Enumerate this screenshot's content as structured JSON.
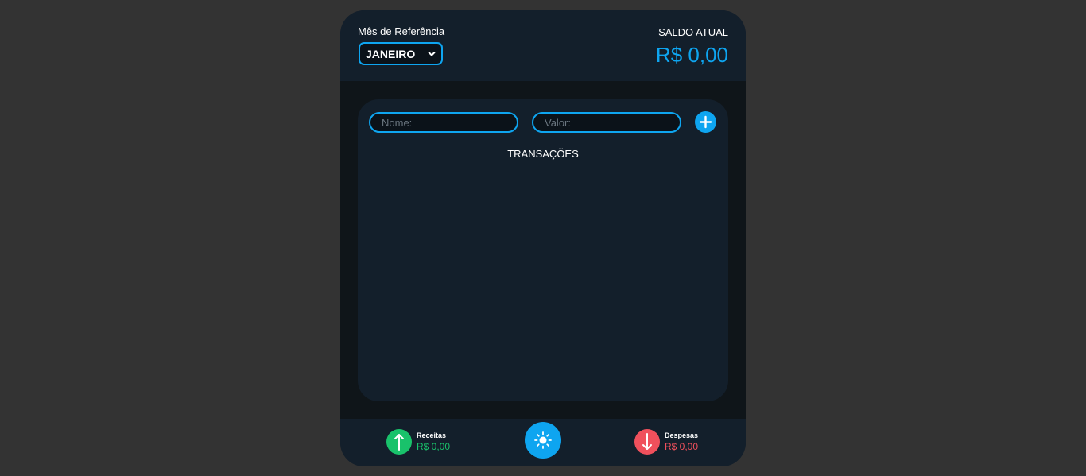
{
  "header": {
    "month_label": "Mês de Referência",
    "selected_month": "JANEIRO",
    "saldo_label": "SALDO ATUAL",
    "saldo_value": "R$ 0,00"
  },
  "form": {
    "nome_placeholder": "Nome:",
    "valor_placeholder": "Valor:",
    "add_icon": "plus-icon"
  },
  "transactions": {
    "title": "TRANSAÇÕES",
    "items": []
  },
  "footer": {
    "receitas_label": "Receitas",
    "receitas_value": "R$ 0,00",
    "despesas_label": "Despesas",
    "despesas_value": "R$ 0,00",
    "theme_icon": "sun-icon"
  },
  "colors": {
    "accent": "#0ea5f0",
    "income": "#19c26b",
    "expense": "#f0505c",
    "background": "#333333",
    "card": "#131f2b"
  }
}
